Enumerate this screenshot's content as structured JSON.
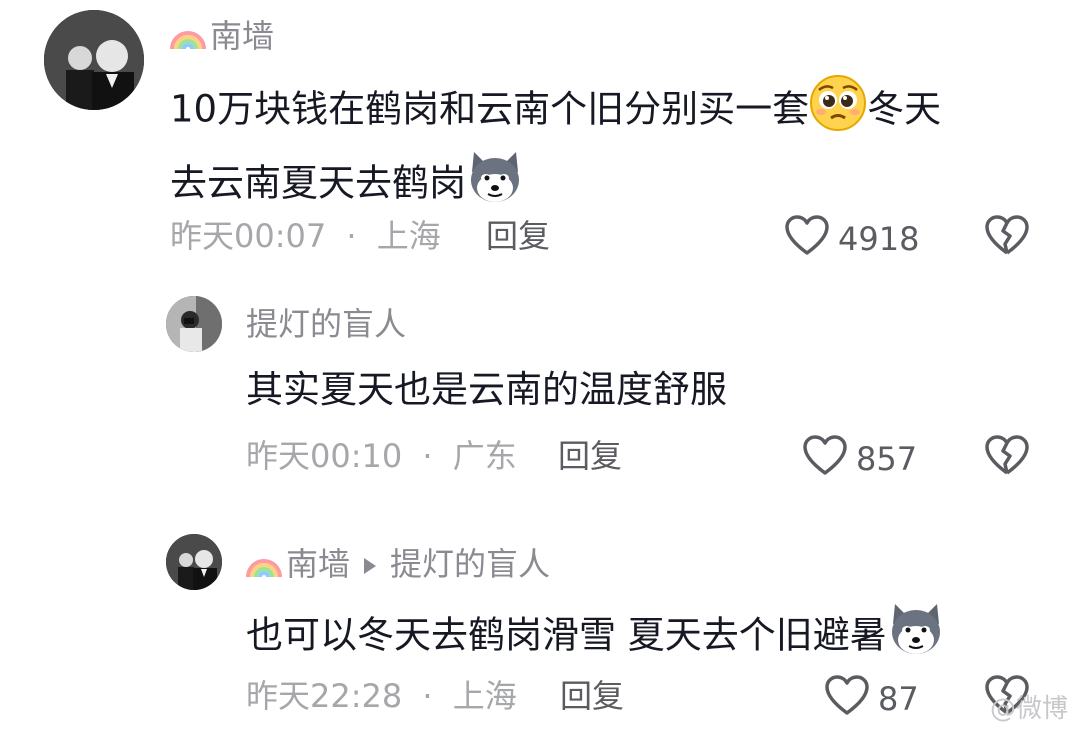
{
  "comments": [
    {
      "author": "南墙",
      "text_part1": "10万块钱在鹤岗和云南个旧分别买一套",
      "text_part2": "冬天",
      "text_line2": "去云南夏天去鹤岗",
      "time": "昨天00:07",
      "location": "上海",
      "reply_label": "回复",
      "likes": "4918"
    },
    {
      "author": "提灯的盲人",
      "text": "其实夏天也是云南的温度舒服",
      "time": "昨天00:10",
      "location": "广东",
      "reply_label": "回复",
      "likes": "857"
    },
    {
      "author": "南墙",
      "reply_to": "提灯的盲人",
      "text": "也可以冬天去鹤岗滑雪 夏天去个旧避暑",
      "time": "昨天22:28",
      "location": "上海",
      "reply_label": "回复",
      "likes": "87"
    }
  ],
  "separator": "·",
  "icons": {
    "like": "heart-outline-icon",
    "dislike": "broken-heart-icon",
    "emoji_face": "pleading-face-emoji",
    "emoji_dog": "husky-dog-emoji",
    "name_badge": "rainbow-icon"
  },
  "watermark": "@微博"
}
